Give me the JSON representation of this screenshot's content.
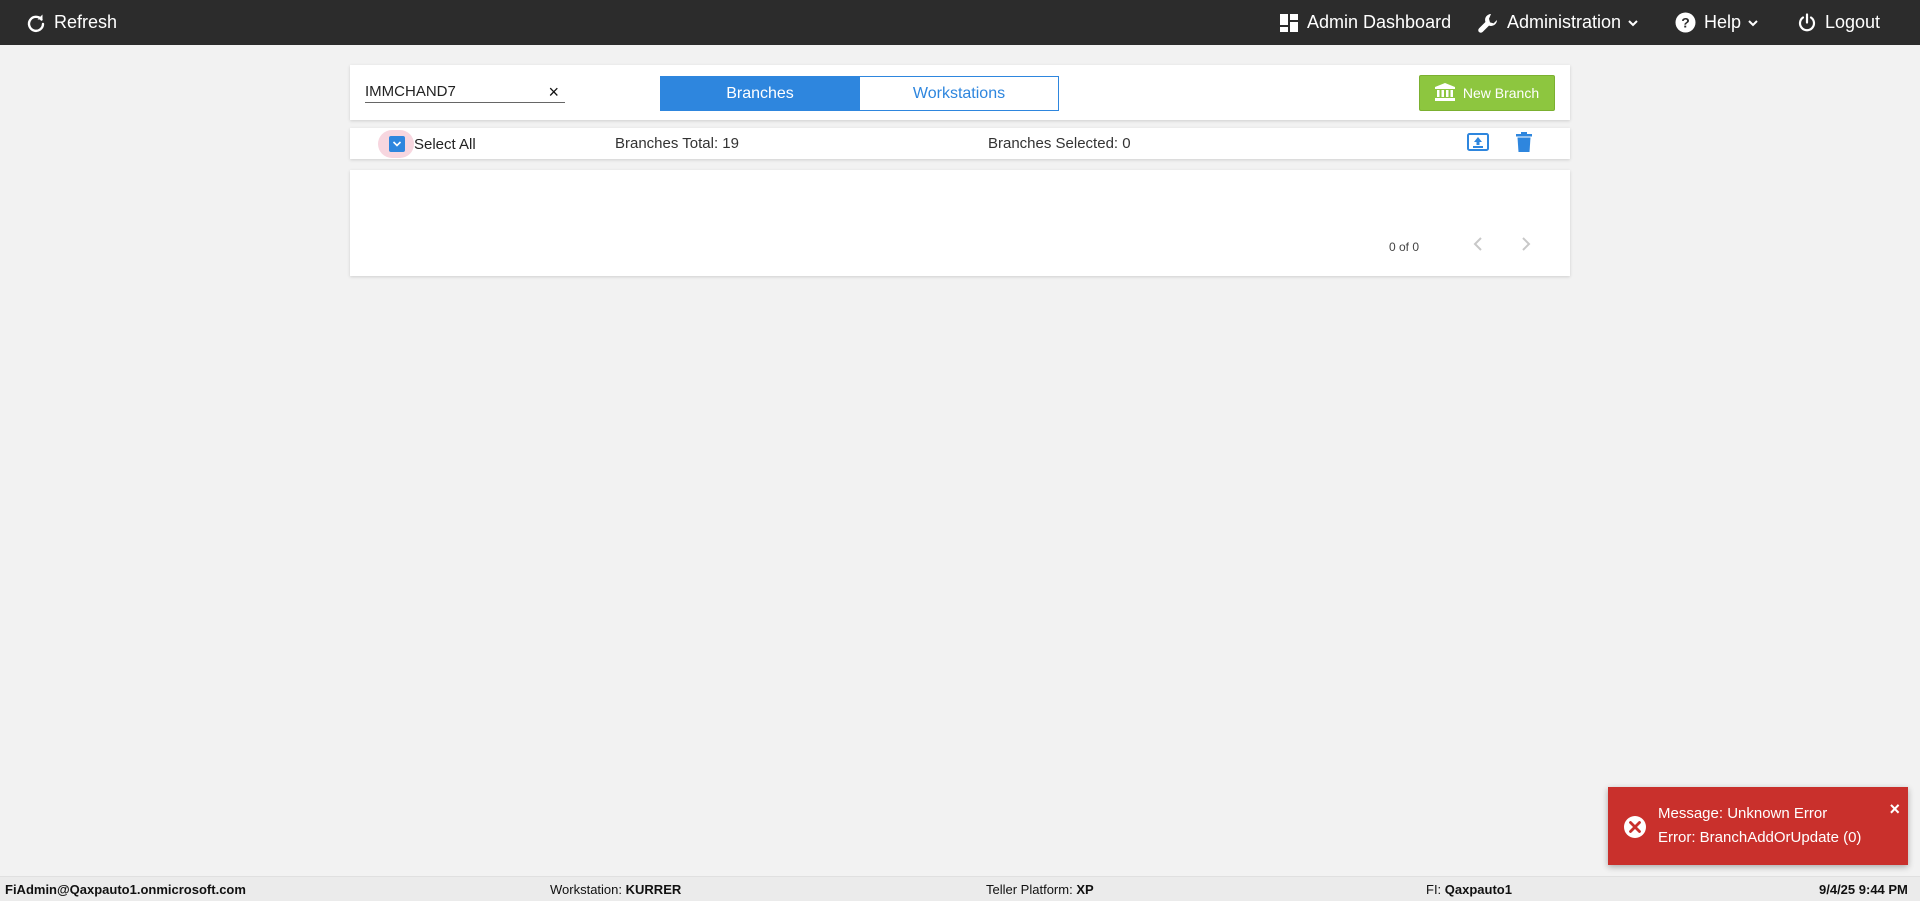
{
  "topbar": {
    "refresh_label": "Refresh",
    "dashboard_label": "Admin Dashboard",
    "administration_label": "Administration",
    "help_label": "Help",
    "logout_label": "Logout"
  },
  "search": {
    "value": "IMMCHAND7",
    "clear_glyph": "×"
  },
  "tabs": {
    "branches_label": "Branches",
    "workstations_label": "Workstations",
    "active": "Branches"
  },
  "new_branch_label": "New Branch",
  "selection": {
    "select_all_label": "Select All",
    "total_text": "Branches Total: 19",
    "selected_text": "Branches Selected: 0",
    "select_all_checked": true
  },
  "pager": {
    "text": "0 of 0"
  },
  "toast": {
    "line1": "Message: Unknown Error",
    "line2": "Error: BranchAddOrUpdate (0)",
    "close_glyph": "×",
    "color": "#c9302c"
  },
  "footer": {
    "user": "FiAdmin@Qaxpauto1.onmicrosoft.com",
    "workstation_label": "Workstation:",
    "workstation_value": "KURRER",
    "teller_platform_label": "Teller Platform:",
    "teller_platform_value": "XP",
    "fi_label": "FI:",
    "fi_value": "Qaxpauto1",
    "datetime": "9/4/25 9:44 PM"
  },
  "colors": {
    "accent": "#2e86de",
    "new_button": "#8dc63f",
    "topbar": "#2c2c2c",
    "error": "#c9302c"
  },
  "icons": {
    "refresh": "refresh-icon",
    "dashboard": "dashboard-grid-icon",
    "administration": "wrench-icon",
    "help": "question-circle-icon",
    "logout": "power-icon",
    "new_branch": "bank-icon",
    "upload": "upload-icon",
    "trash": "trash-icon",
    "error": "error-circle-x-icon"
  }
}
